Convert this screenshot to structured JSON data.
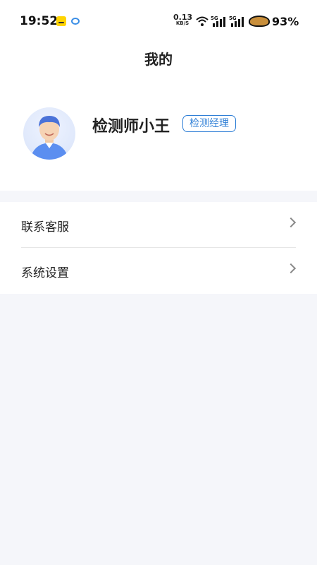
{
  "status_bar": {
    "time": "19:52",
    "net_speed_value": "0.13",
    "net_speed_unit": "KB/S",
    "battery_percent": "93%",
    "icons": [
      "app-notification-icon",
      "chat-bubble-icon",
      "wifi-icon",
      "signal-5g-icon",
      "signal-5g-icon",
      "battery-icon"
    ]
  },
  "header": {
    "title": "我的"
  },
  "profile": {
    "name": "检测师小王",
    "role": "检测经理"
  },
  "menu": {
    "items": [
      {
        "label": "联系客服",
        "icon": "chevron-right-icon"
      },
      {
        "label": "系统设置",
        "icon": "chevron-right-icon"
      }
    ]
  },
  "colors": {
    "accent": "#2f7fd6",
    "background": "#f5f6fa",
    "card": "#ffffff"
  }
}
